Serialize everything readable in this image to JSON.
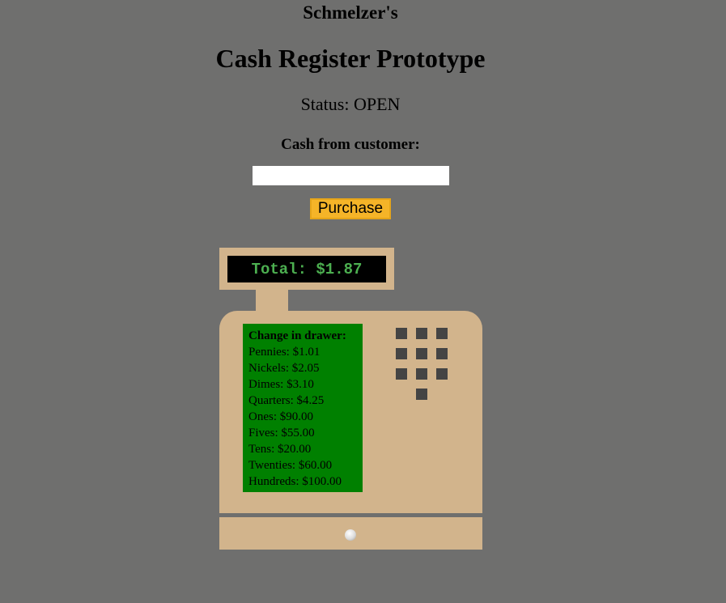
{
  "header": {
    "brand": "Schmelzer's",
    "title": "Cash Register Prototype",
    "status": "Status: OPEN"
  },
  "form": {
    "cash_label": "Cash from customer:",
    "cash_value": "",
    "purchase_label": "Purchase"
  },
  "register": {
    "total_display": "Total: $1.87",
    "drawer": {
      "title": "Change in drawer:",
      "items": [
        "Pennies: $1.01",
        "Nickels: $2.05",
        "Dimes: $3.10",
        "Quarters: $4.25",
        "Ones: $90.00",
        "Fives: $55.00",
        "Tens: $20.00",
        "Twenties: $60.00",
        "Hundreds: $100.00"
      ]
    }
  },
  "colors": {
    "background": "#6f6f6e",
    "register": "#d2b48c",
    "drawer_panel": "#008000",
    "display_text": "#4caf50",
    "button": "#f5b428",
    "keys": "#444444"
  }
}
